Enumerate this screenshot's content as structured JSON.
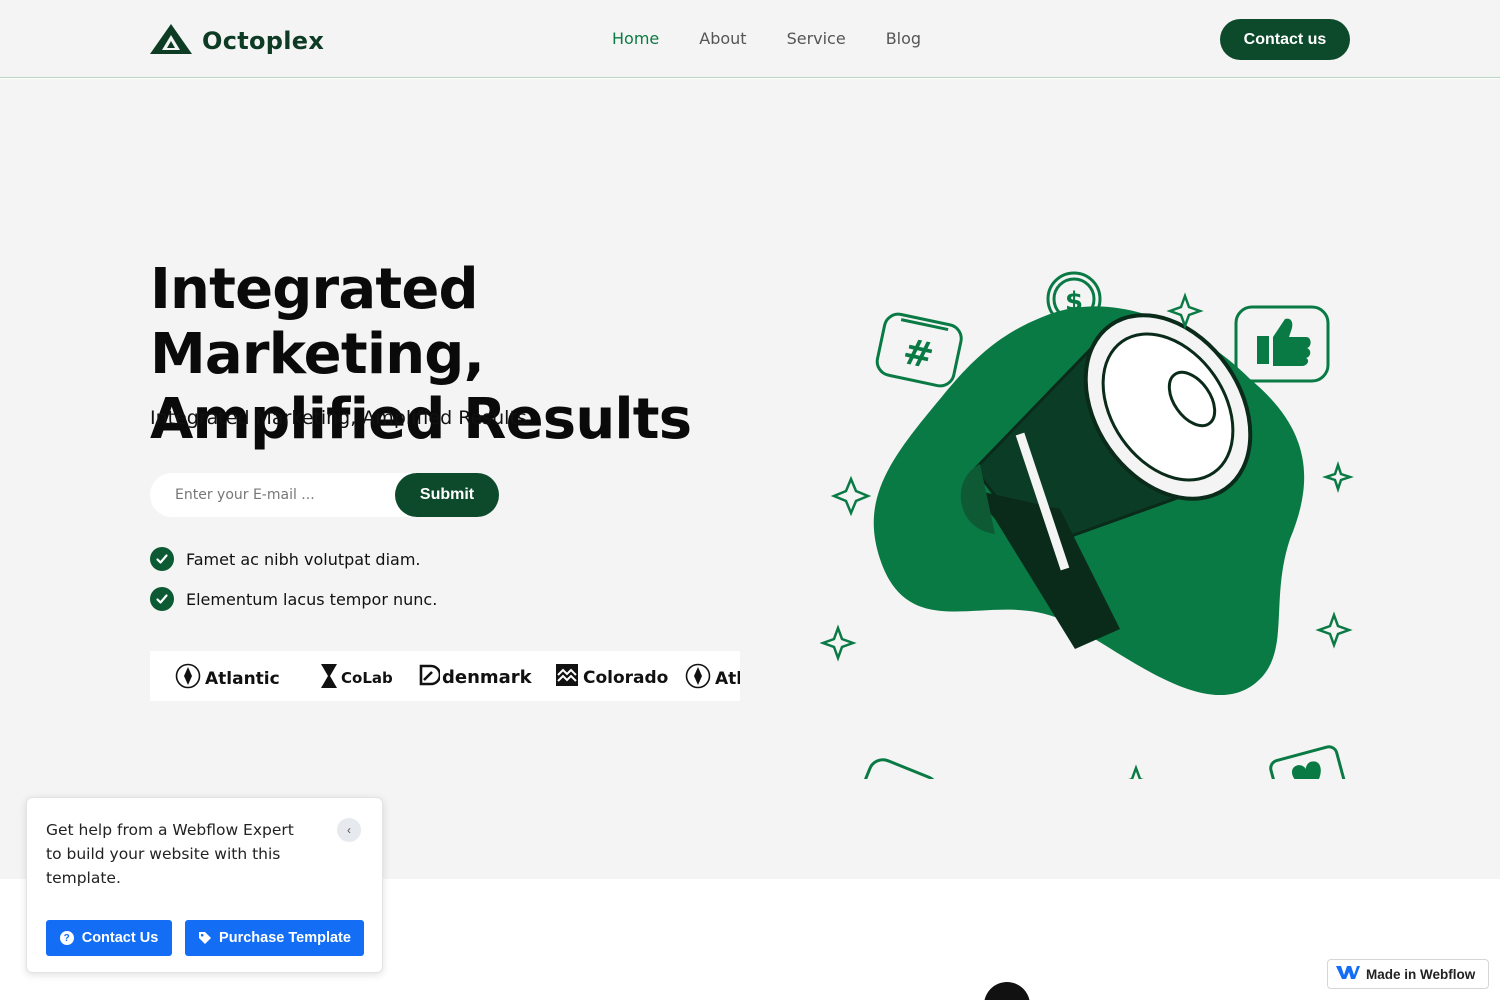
{
  "header": {
    "brand": "Octoplex",
    "nav": [
      "Home",
      "About",
      "Service",
      "Blog"
    ],
    "active_nav": "Home",
    "cta_label": "Contact us"
  },
  "hero": {
    "title": "Integrated Marketing, Amplified Results",
    "subtitle": "Integrated Marketing, Amplified Results",
    "email_placeholder": "Enter your E-mail ...",
    "submit_label": "Submit",
    "features": [
      "Famet ac nibh volutpat diam.",
      "Elementum lacus tempor nunc."
    ],
    "brands": [
      "Atlantic",
      "CoLab",
      "denmark",
      "Colorado",
      "Atlantic"
    ]
  },
  "popup": {
    "message": "Get help from a Webflow Expert to build your website with this template.",
    "contact_label": "Contact Us",
    "purchase_label": "Purchase Template"
  },
  "badge": {
    "label": "Made in Webflow"
  },
  "colors": {
    "brand_dark": "#0d4a2c",
    "brand_green": "#0b7a43",
    "illustration_green": "#0a7a45",
    "webflow_blue": "#146ef5"
  }
}
